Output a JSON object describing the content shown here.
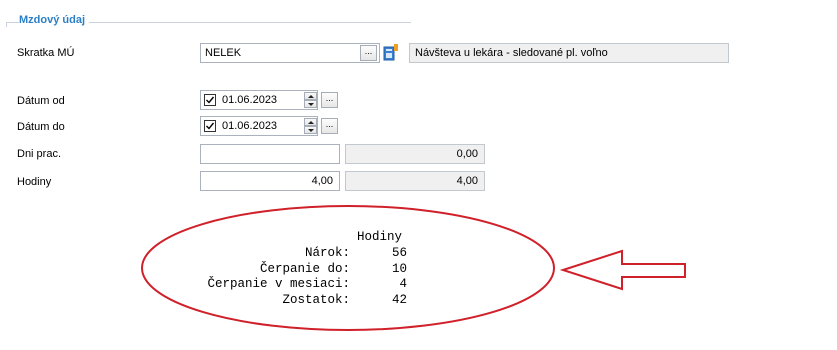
{
  "section": {
    "title": "Mzdový údaj"
  },
  "fields": {
    "skratka": {
      "label": "Skratka MÚ",
      "value": "NELEK",
      "description": "Návšteva u lekára - sledované pl. voľno"
    },
    "datum_od": {
      "label": "Dátum od",
      "value": "01.06.2023",
      "checked": true
    },
    "datum_do": {
      "label": "Dátum do",
      "value": "01.06.2023",
      "checked": true
    },
    "dni_prac": {
      "label": "Dni prac.",
      "value": "",
      "computed": "0,00"
    },
    "hodiny": {
      "label": "Hodiny",
      "value": "4,00",
      "computed": "4,00"
    }
  },
  "buttons": {
    "dots": "..."
  },
  "summary": {
    "header": "Hodiny",
    "rows": [
      {
        "label": "Nárok:",
        "value": "56"
      },
      {
        "label": "Čerpanie do:",
        "value": "10"
      },
      {
        "label": "Čerpanie v mesiaci:",
        "value": "4"
      },
      {
        "label": "Zostatok:",
        "value": "42"
      }
    ]
  },
  "annotation_color": "#d0202a"
}
